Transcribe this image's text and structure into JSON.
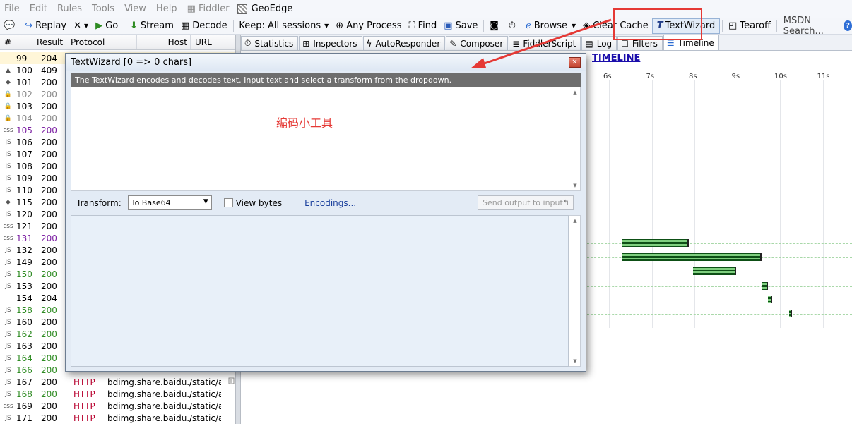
{
  "menu": [
    "File",
    "Edit",
    "Rules",
    "Tools",
    "View",
    "Help",
    "Fiddler",
    "GeoEdge"
  ],
  "toolbar": {
    "replay": "Replay",
    "go": "Go",
    "stream": "Stream",
    "decode": "Decode",
    "keep": "Keep: All sessions",
    "any_process": "Any Process",
    "find": "Find",
    "save": "Save",
    "browse": "Browse",
    "clear_cache": "Clear Cache",
    "textwizard": "TextWizard",
    "tearoff": "Tearoff",
    "msdn_search": "MSDN Search..."
  },
  "session_list": {
    "headers": {
      "id": "#",
      "result": "Result",
      "protocol": "Protocol",
      "host": "Host",
      "url": "URL"
    },
    "rows": [
      {
        "id": "99",
        "icon": "i",
        "result": "204",
        "color": "#000000"
      },
      {
        "id": "100",
        "icon": "▲",
        "result": "409",
        "color": "#000000"
      },
      {
        "id": "101",
        "icon": "◆",
        "result": "200",
        "color": "#000000"
      },
      {
        "id": "102",
        "icon": "🔒",
        "result": "200",
        "color": "#8a8a8a"
      },
      {
        "id": "103",
        "icon": "🔒",
        "result": "200",
        "color": "#000000"
      },
      {
        "id": "104",
        "icon": "🔒",
        "result": "200",
        "color": "#8a8a8a"
      },
      {
        "id": "105",
        "icon": "css",
        "result": "200",
        "color": "#7b1fa2"
      },
      {
        "id": "106",
        "icon": "JS",
        "result": "200",
        "color": "#000000"
      },
      {
        "id": "107",
        "icon": "JS",
        "result": "200",
        "color": "#000000"
      },
      {
        "id": "108",
        "icon": "JS",
        "result": "200",
        "color": "#000000"
      },
      {
        "id": "109",
        "icon": "JS",
        "result": "200",
        "color": "#000000"
      },
      {
        "id": "110",
        "icon": "JS",
        "result": "200",
        "color": "#000000"
      },
      {
        "id": "115",
        "icon": "◆",
        "result": "200",
        "color": "#000000"
      },
      {
        "id": "120",
        "icon": "JS",
        "result": "200",
        "color": "#000000"
      },
      {
        "id": "121",
        "icon": "css",
        "result": "200",
        "color": "#000000"
      },
      {
        "id": "131",
        "icon": "css",
        "result": "200",
        "color": "#7b1fa2"
      },
      {
        "id": "132",
        "icon": "JS",
        "result": "200",
        "color": "#000000"
      },
      {
        "id": "149",
        "icon": "JS",
        "result": "200",
        "color": "#000000"
      },
      {
        "id": "150",
        "icon": "JS",
        "result": "200",
        "color": "#2e8b22"
      },
      {
        "id": "153",
        "icon": "JS",
        "result": "200",
        "color": "#000000"
      },
      {
        "id": "154",
        "icon": "i",
        "result": "204",
        "color": "#000000"
      },
      {
        "id": "158",
        "icon": "JS",
        "result": "200",
        "color": "#2e8b22"
      },
      {
        "id": "160",
        "icon": "JS",
        "result": "200",
        "color": "#000000"
      },
      {
        "id": "162",
        "icon": "JS",
        "result": "200",
        "color": "#2e8b22"
      },
      {
        "id": "163",
        "icon": "JS",
        "result": "200",
        "color": "#000000"
      },
      {
        "id": "164",
        "icon": "JS",
        "result": "200",
        "color": "#2e8b22"
      },
      {
        "id": "166",
        "icon": "JS",
        "result": "200",
        "color": "#2e8b22"
      },
      {
        "id": "167",
        "icon": "JS",
        "result": "200",
        "color": "#000000",
        "protocol": "HTTP",
        "host": "bdimg.share.baidu....",
        "url": "/static/ap"
      },
      {
        "id": "168",
        "icon": "JS",
        "result": "200",
        "color": "#2e8b22",
        "protocol": "HTTP",
        "host": "bdimg.share.baidu....",
        "url": "/static/ap"
      },
      {
        "id": "169",
        "icon": "css",
        "result": "200",
        "color": "#000000",
        "protocol": "HTTP",
        "host": "bdimg.share.baidu....",
        "url": "/static/ap"
      },
      {
        "id": "171",
        "icon": "JS",
        "result": "200",
        "color": "#000000",
        "protocol": "HTTP",
        "host": "bdimg.share.baidu....",
        "url": "/static/ap"
      }
    ]
  },
  "tabs": [
    "Statistics",
    "Inspectors",
    "AutoResponder",
    "Composer",
    "FiddlerScript",
    "Log",
    "Filters",
    "Timeline"
  ],
  "timeline": {
    "title": "TIMELINE",
    "ticks": [
      "6s",
      "7s",
      "8s",
      "9s",
      "10s",
      "11s"
    ],
    "bars": [
      {
        "start": 6.45,
        "end": 8.0
      },
      {
        "start": 6.45,
        "end": 9.7
      },
      {
        "start": 8.1,
        "end": 9.1
      },
      {
        "start": 9.7,
        "end": 9.85
      },
      {
        "start": 9.85,
        "end": 9.95
      },
      {
        "start": 10.35,
        "end": 10.42
      }
    ]
  },
  "textwizard": {
    "title": "TextWizard [0 => 0 chars]",
    "info": "The TextWizard encodes and decodes text. Input text and select a transform from the dropdown.",
    "annotation": "编码小工具",
    "transform_label": "Transform:",
    "transform_value": "To Base64",
    "view_bytes_label": "View bytes",
    "view_bytes_checked": false,
    "encodings_link": "Encodings...",
    "send_output_label": "Send output to input",
    "input_text": "",
    "output_text": ""
  },
  "colors": {
    "highlight": "#e53935",
    "protocol_text": "#b8002e",
    "timeline_bar": "#0d4f15"
  }
}
